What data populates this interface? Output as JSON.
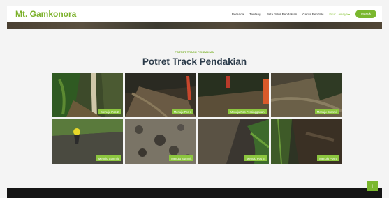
{
  "header": {
    "brand": "Mt. Gamkonora",
    "nav": [
      {
        "label": "Beranda"
      },
      {
        "label": "Tentang"
      },
      {
        "label": "Peta Jalur Pendakian"
      },
      {
        "label": "Cerita Pendaki"
      },
      {
        "label": "Fitur Lainnya"
      }
    ],
    "login_label": "Masuk"
  },
  "section": {
    "kicker": "POTRET TRACK PENDAKIAN",
    "title": "Potret Track Pendakian"
  },
  "gallery": {
    "tiles": [
      {
        "label": "Menuju Pos 2"
      },
      {
        "label": "Menuju Pos 3"
      },
      {
        "label": "Menuju Pos Persinggahan"
      },
      {
        "label": "Menuju Summit"
      },
      {
        "label": "Menuju Summit"
      },
      {
        "label": "Menuju Summit"
      },
      {
        "label": "Menuju Pos 5"
      },
      {
        "label": "Menuju Pos 5"
      }
    ]
  },
  "back_to_top": "↑",
  "colors": {
    "accent": "#8cc63f",
    "footer": "#151515"
  }
}
